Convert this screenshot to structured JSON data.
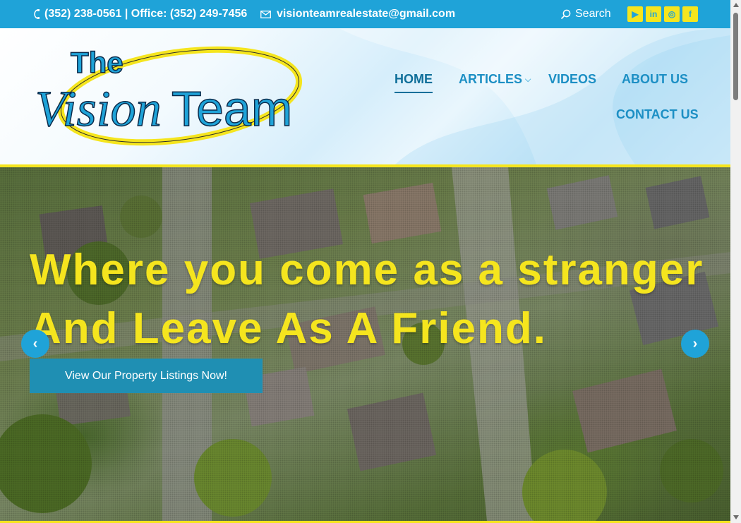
{
  "topbar": {
    "phone_text": "(352) 238-0561 | Office: (352) 249-7456",
    "email_text": "visionteamrealestate@gmail.com",
    "search_label": "Search",
    "social": [
      {
        "name": "youtube",
        "glyph": "▶"
      },
      {
        "name": "linkedin",
        "glyph": "in"
      },
      {
        "name": "instagram",
        "glyph": "◎"
      },
      {
        "name": "facebook",
        "glyph": "f"
      }
    ]
  },
  "logo": {
    "line1": "The",
    "line2a": "Vision",
    "line2b": "Team"
  },
  "nav": {
    "items": [
      {
        "label": "HOME",
        "active": true
      },
      {
        "label": "ARTICLES",
        "has_submenu": true
      },
      {
        "label": "VIDEOS"
      },
      {
        "label": "ABOUT US"
      },
      {
        "label": "CONTACT US"
      }
    ]
  },
  "hero": {
    "headline_line1": "Where you come as a stranger",
    "headline_line2": "And Leave As A Friend.",
    "cta_label": "View Our Property Listings Now!",
    "prev_glyph": "‹",
    "next_glyph": "›"
  },
  "colors": {
    "brand_blue": "#1fa3d8",
    "accent_yellow": "#f5e51e",
    "cta_blue": "#1f8fb3",
    "nav_blue": "#1c8fc4"
  }
}
